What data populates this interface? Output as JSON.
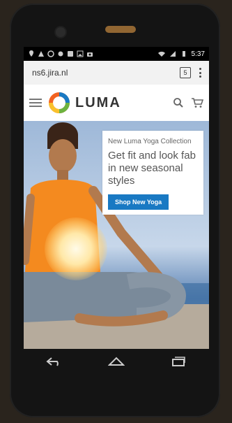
{
  "status": {
    "time": "5:37"
  },
  "browser": {
    "url": "ns6.jira.nl",
    "tab_count": "5"
  },
  "site": {
    "brand": "LUMA",
    "promo": {
      "subtitle": "New Luma Yoga Collection",
      "title": "Get fit and look fab in new seasonal styles",
      "cta": "Shop New Yoga"
    }
  },
  "colors": {
    "accent": "#1979c3"
  }
}
